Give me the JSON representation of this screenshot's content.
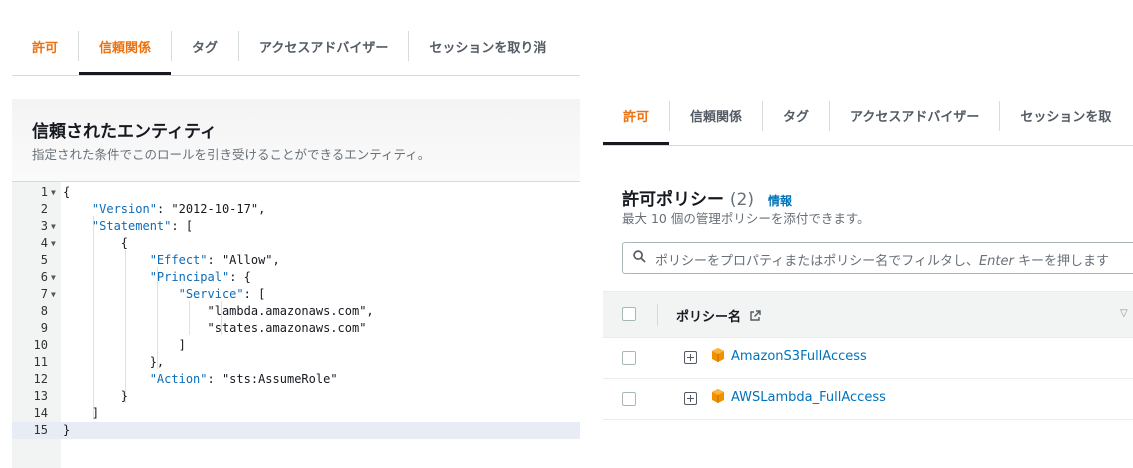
{
  "left": {
    "tabs": [
      {
        "label": "許可"
      },
      {
        "label": "信頼関係"
      },
      {
        "label": "タグ"
      },
      {
        "label": "アクセスアドバイザー"
      },
      {
        "label": "セッションを取り消"
      }
    ],
    "trust": {
      "title": "信頼されたエンティティ",
      "description": "指定された条件でこのロールを引き受けることができるエンティティ。"
    },
    "code_lines": [
      "{",
      "    \"Version\": \"2012-10-17\",",
      "    \"Statement\": [",
      "        {",
      "            \"Effect\": \"Allow\",",
      "            \"Principal\": {",
      "                \"Service\": [",
      "                    \"lambda.amazonaws.com\",",
      "                    \"states.amazonaws.com\"",
      "                ]",
      "            },",
      "            \"Action\": \"sts:AssumeRole\"",
      "        }",
      "    ]",
      "}"
    ],
    "line_numbers": [
      "1",
      "2",
      "3",
      "4",
      "5",
      "6",
      "7",
      "8",
      "9",
      "10",
      "11",
      "12",
      "13",
      "14",
      "15"
    ]
  },
  "right": {
    "tabs": [
      {
        "label": "許可"
      },
      {
        "label": "信頼関係"
      },
      {
        "label": "タグ"
      },
      {
        "label": "アクセスアドバイザー"
      },
      {
        "label": "セッションを取"
      }
    ],
    "policies": {
      "title": "許可ポリシー",
      "count": "(2)",
      "info": "情報",
      "description": "最大 10 個の管理ポリシーを添付できます。",
      "search_placeholder_prefix": "ポリシーをプロパティまたはポリシー名でフィルタし、",
      "search_placeholder_key": "Enter",
      "search_placeholder_suffix": " キーを押します",
      "column_name": "ポリシー名",
      "rows": [
        {
          "name": "AmazonS3FullAccess"
        },
        {
          "name": "AWSLambda_FullAccess"
        }
      ]
    }
  },
  "colors": {
    "accent": "#ec7211",
    "link": "#0073bb",
    "aws_icon": "#f29100"
  }
}
